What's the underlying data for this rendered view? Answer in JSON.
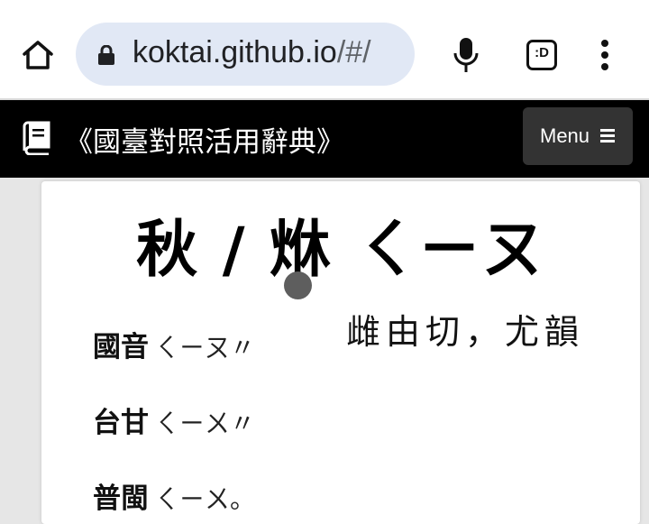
{
  "browser": {
    "url_host": "koktai.github.io",
    "url_path": "/#/",
    "icons": [
      "home-icon",
      "lock-icon",
      "microphone-icon",
      "extension-icon",
      "more-vert-icon"
    ],
    "extension_label": ":D"
  },
  "navbar": {
    "title": "《國臺對照活用辭典》",
    "menu_label": "Menu",
    "icons": [
      "book-icon",
      "bars-icon"
    ],
    "background": "#000000"
  },
  "entry": {
    "headword": "秋 / 烌 ㄑㄧㄡ",
    "fanqie": "雌由切，尤韻",
    "readings": [
      {
        "label": "國音",
        "value": "ㄑㄧㄡ〃"
      },
      {
        "label": "台甘",
        "value": "ㄑㄧㄨ〃"
      },
      {
        "label": "普閩",
        "value": "ㄑㄧㄨ。"
      }
    ]
  }
}
